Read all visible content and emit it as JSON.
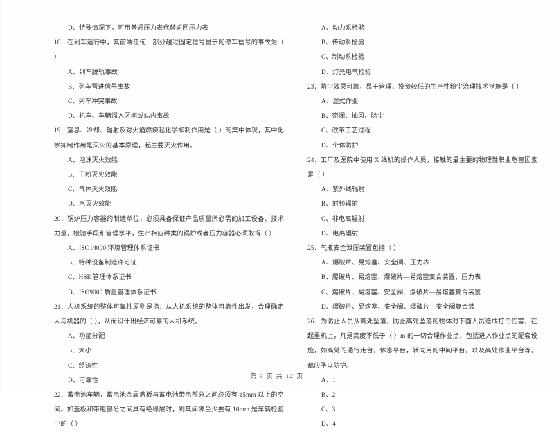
{
  "document": {
    "footer": "第 3 页 共 12 页",
    "page_number": "3",
    "total_pages": "12"
  },
  "left_column": {
    "orphan_option": "D、特殊情况下，可用普通压力表代替返回压力表",
    "questions": [
      {
        "number": "18",
        "stem": "18．在列车运行中，其前端任何一部分越过固定信号显示的停车信号的事故为（        ）",
        "options": [
          "A、列车脱轨事故",
          "B、列车冒进信号事故",
          "C、列车冲突事故",
          "D、机车、车辆溜入区间或站内事故"
        ]
      },
      {
        "number": "19",
        "stem": "19．窒息、冷却、辐射及对火焰燃烧起化学抑制作用是（        ）的集中体现，其中化学抑制作用是灭火的基本原理，起主要灭火作用。",
        "options": [
          "A、泡沫灭火效能",
          "B、干粉灭火效能",
          "C、气体灭火效能",
          "D、水灭火效能"
        ]
      },
      {
        "number": "20",
        "stem": "20．锅炉压力容器的制造单位，必须具备保证产品质量所必需的加工设备、技术力量，检验手段和管理水平，生产相应种类的锅炉或者压力容器必须取得（        ）",
        "options": [
          "A、ISO14000 环境管理体系证书",
          "B、特种设备制造许可证",
          "C、HSE 管理体系证书",
          "D、ISO9000 质量管理体系证书"
        ]
      },
      {
        "number": "21",
        "stem": "21．人机系统的整体可靠性原则是指：从人机系统的整体可靠性出发，合理确定人与机器的（        ），从而设计出经济可靠的人机系统。",
        "options": [
          "A、功能分配",
          "B、大小",
          "C、经济性",
          "D、可靠性"
        ]
      },
      {
        "number": "22",
        "stem": "22．蓄电池车辆，蓄电池金属盖板与蓄电池带电部分之间必须有 15mm 以上的空间。如盖板和带电部分之间具有绝缘层时，则其间隙至少要有 10mm 是车辆检验中的（        ）",
        "options": []
      }
    ]
  },
  "right_column": {
    "continued_options": [
      "A、动力系检验",
      "B、传动系检验",
      "C、制动系检验",
      "D、灯光电气检验"
    ],
    "questions": [
      {
        "number": "23",
        "stem": "23．防尘效果可靠，易于管理，投资较低的生产性粉尘治理技术措施是（        ）",
        "options": [
          "A、湿式作业",
          "B、密闭、抽风、除尘",
          "C、改革工艺过程",
          "D、个体防护"
        ]
      },
      {
        "number": "24",
        "stem": "24．工厂及医院中使用 X 线机的操作人员，接触的最主要的物理性职业危害因素是（        ）",
        "options": [
          "A、紫外线辐射",
          "B、射频辐射",
          "C、非电离辐射",
          "D、电离辐射"
        ]
      },
      {
        "number": "25",
        "stem": "25．气瓶安全泄压装置包括（        ）",
        "options": [
          "A、爆破片、易熔塞、安全阀、压力表",
          "B、爆破片、易熔塞、爆破片—易熔塞复合装置、压力表",
          "C、爆破片、易熔塞、安全阀、爆破片—易熔塞复合装置",
          "D、爆破片、易熔塞、安全阀、爆破片—安全阀复合装"
        ]
      },
      {
        "number": "26",
        "stem": "26．为防止人员从高处坠落，防止高处坠落的物体对下面人员造成打击伤害，在起重机上，凡是高度不低于（        ）m 的一切合理作业点，包括进入作业点的配套设施，如高处的通行走台，休息平台，转向用的中间平台，以及高处作业平台等，都应予以防护。",
        "options": [
          "A、1",
          "B、2",
          "C、3",
          "D、4"
        ]
      }
    ]
  }
}
